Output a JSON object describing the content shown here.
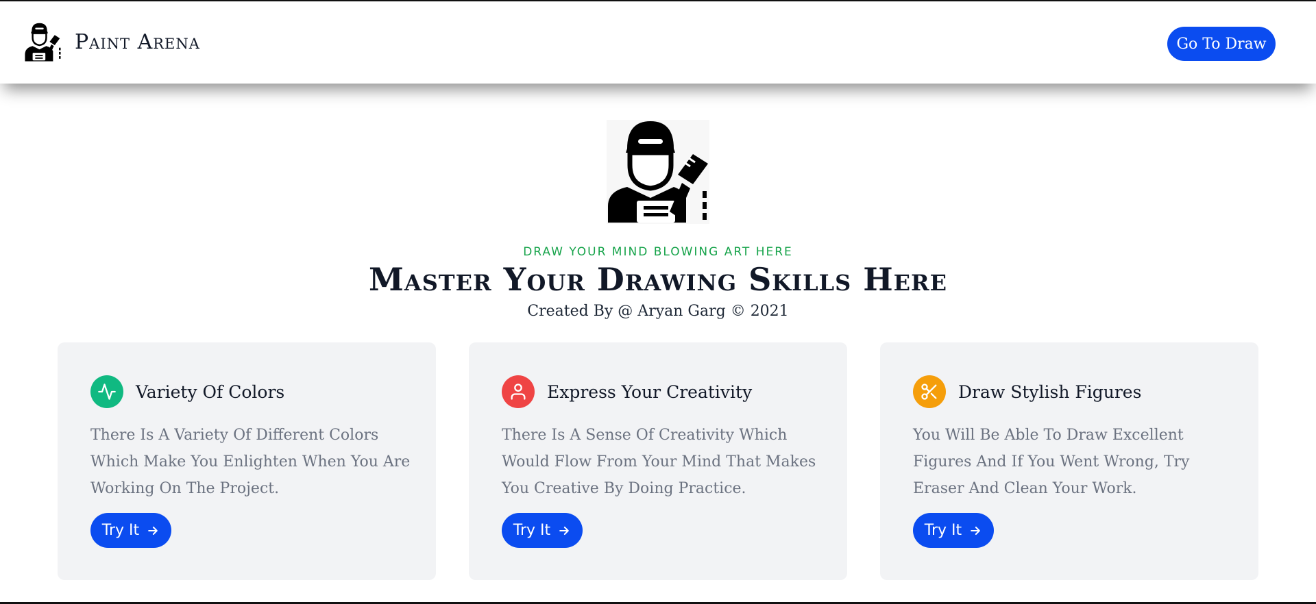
{
  "header": {
    "brand_name": "Paint Arena",
    "go_button": "Go To Draw"
  },
  "hero": {
    "tagline": "DRAW YOUR MIND BLOWING ART HERE",
    "headline": "Master Your Drawing Skills Here",
    "credit": "Created By @ Aryan Garg © 2021"
  },
  "cards": [
    {
      "title": "Variety Of Colors",
      "text": "There Is A Variety Of Different Colors Which Make You Enlighten When You Are Working On The Project.",
      "button": "Try It",
      "icon": "activity-icon",
      "color": "#10b981"
    },
    {
      "title": "Express Your Creativity",
      "text": "There Is A Sense Of Creativity Which Would Flow From Your Mind That Makes You Creative By Doing Practice.",
      "button": "Try It",
      "icon": "user-icon",
      "color": "#ef4444"
    },
    {
      "title": "Draw Stylish Figures",
      "text": "You Will Be Able To Draw Excellent Figures And If You Went Wrong, Try Eraser And Clean Your Work.",
      "button": "Try It",
      "icon": "scissors-icon",
      "color": "#f59e0b"
    }
  ],
  "colors": {
    "accent": "#0b4cf0",
    "tagline": "#16a34a",
    "card_bg": "#f2f3f5"
  }
}
